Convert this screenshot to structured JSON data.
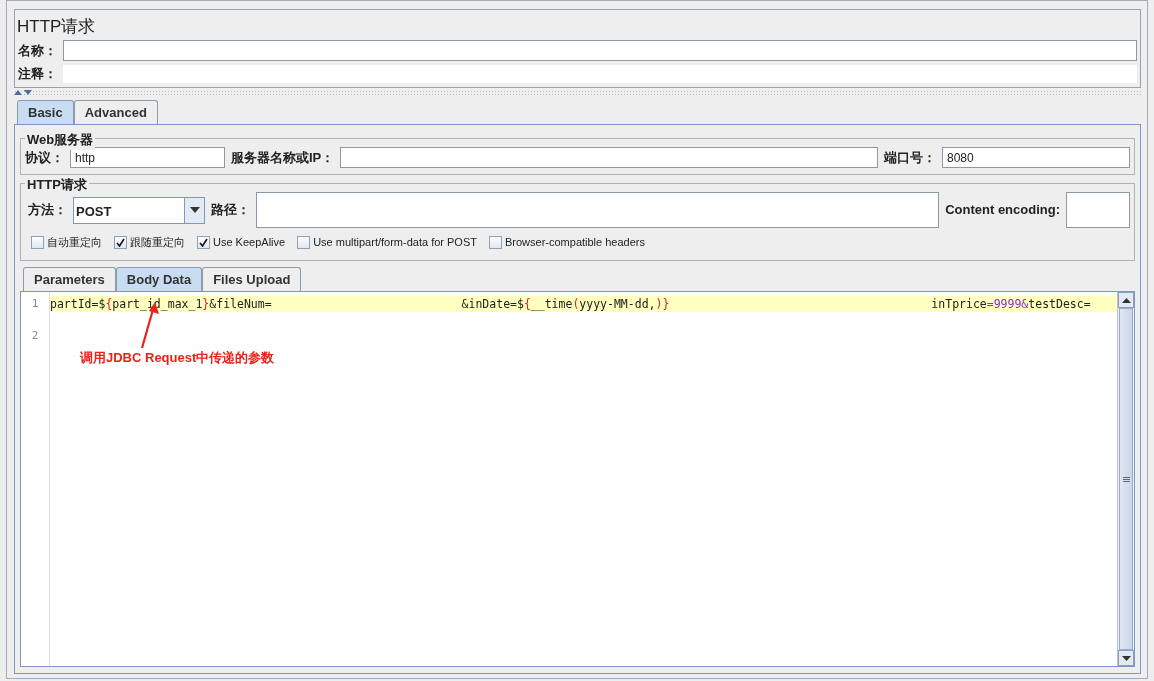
{
  "panel": {
    "title": "HTTP请求",
    "name_label": "名称：",
    "comment_label": "注释："
  },
  "tabs": [
    {
      "label": "Basic",
      "selected": true
    },
    {
      "label": "Advanced",
      "selected": false
    }
  ],
  "web_server": {
    "legend": "Web服务器",
    "protocol_label": "协议：",
    "protocol": "http",
    "server_label": "服务器名称或IP：",
    "port_label": "端口号：",
    "port": "8080"
  },
  "http_request": {
    "legend": "HTTP请求",
    "method_label": "方法：",
    "method": "POST",
    "path_label": "路径：",
    "encoding_label": "Content encoding:"
  },
  "options": [
    {
      "label": "自动重定向",
      "checked": false
    },
    {
      "label": "跟随重定向",
      "checked": true
    },
    {
      "label": "Use KeepAlive",
      "checked": true
    },
    {
      "label": "Use multipart/form-data for POST",
      "checked": false
    },
    {
      "label": "Browser-compatible headers",
      "checked": false
    }
  ],
  "body_tabs": [
    {
      "label": "Parameters",
      "selected": false
    },
    {
      "label": "Body Data",
      "selected": true
    },
    {
      "label": "Files Upload",
      "selected": false
    }
  ],
  "editor": {
    "line_numbers": [
      "1",
      "2"
    ],
    "line1": [
      [
        {
          "kind": "plain",
          "text": "partId=$"
        },
        {
          "kind": "brace",
          "text": "{"
        },
        {
          "kind": "plain",
          "text": "part_id_max_1"
        },
        {
          "kind": "brace",
          "text": "}"
        },
        {
          "kind": "plain",
          "text": "&fileNum="
        }
      ],
      [
        {
          "kind": "plain",
          "text": "&inDate=$"
        },
        {
          "kind": "brace",
          "text": "{"
        },
        {
          "kind": "plain",
          "text": "__time"
        },
        {
          "kind": "brace",
          "text": "("
        },
        {
          "kind": "plain",
          "text": "yyyy-MM-dd,"
        },
        {
          "kind": "brace",
          "text": ")}"
        }
      ],
      [
        {
          "kind": "plain",
          "text": "inTprice"
        },
        {
          "kind": "value",
          "text": "=9999&"
        },
        {
          "kind": "plain",
          "text": "testDesc="
        }
      ]
    ]
  },
  "annotation": {
    "text": "调用JDBC Request中传递的参数"
  }
}
